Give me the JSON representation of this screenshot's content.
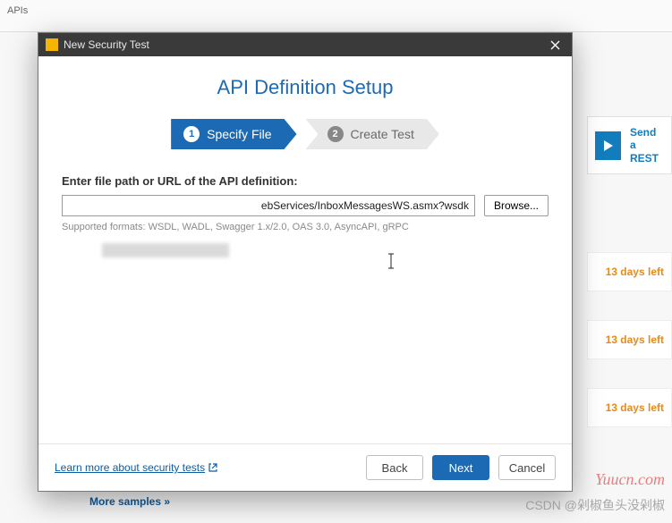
{
  "background": {
    "topbar_fragment": "APIs",
    "send_line1": "Send",
    "send_line2": "a REST",
    "days_left": "13 days left",
    "more_samples": "More samples »"
  },
  "dialog": {
    "title": "New Security Test",
    "heading": "API Definition Setup",
    "steps": {
      "step1_num": "1",
      "step1_label": "Specify File",
      "step2_num": "2",
      "step2_label": "Create Test"
    },
    "field_label": "Enter file path or URL of the API definition:",
    "file_input_value": "ebServices/InboxMessagesWS.asmx?wsdk",
    "browse_label": "Browse...",
    "supported_formats": "Supported formats: WSDL, WADL, Swagger 1.x/2.0, OAS 3.0, AsyncAPI, gRPC",
    "learn_more": "Learn more about security tests",
    "buttons": {
      "back": "Back",
      "next": "Next",
      "cancel": "Cancel"
    }
  },
  "watermarks": {
    "yuucn": "Yuucn.com",
    "csdn": "CSDN @剁椒鱼头没剁椒"
  },
  "colors": {
    "primary": "#1c6ab3",
    "accent_orange": "#e58b1a"
  }
}
